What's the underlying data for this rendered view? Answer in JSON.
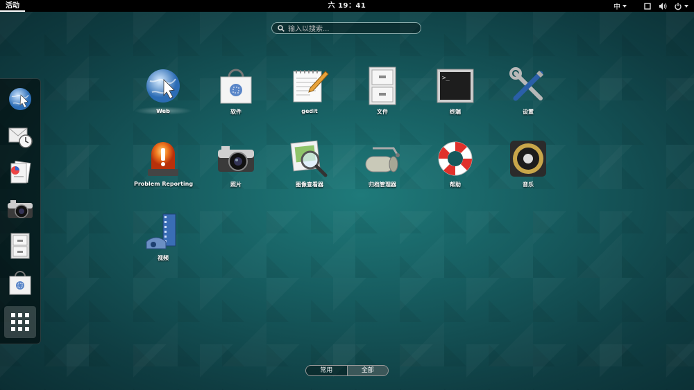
{
  "topbar": {
    "activities_label": "活动",
    "clock": "六 19：41",
    "ime_label": "中",
    "tray_icons": [
      "window-icon",
      "volume-icon",
      "power-icon"
    ]
  },
  "search": {
    "placeholder": "输入以搜索..."
  },
  "dash": {
    "items": [
      {
        "name": "web-browser",
        "icon": "globe-icon"
      },
      {
        "name": "mail-clock",
        "icon": "envelope-clock-icon"
      },
      {
        "name": "documents",
        "icon": "documents-icon"
      },
      {
        "name": "camera",
        "icon": "camera-icon"
      },
      {
        "name": "file-cabinet",
        "icon": "cabinet-icon"
      },
      {
        "name": "software",
        "icon": "shopping-bag-icon"
      },
      {
        "name": "show-applications",
        "icon": "grid-icon"
      }
    ]
  },
  "apps": [
    {
      "label": "Web",
      "icon": "globe-icon"
    },
    {
      "label": "软件",
      "icon": "shopping-bag-icon"
    },
    {
      "label": "gedit",
      "icon": "notepad-pen-icon"
    },
    {
      "label": "文件",
      "icon": "cabinet-icon"
    },
    {
      "label": "终端",
      "icon": "terminal-icon"
    },
    {
      "label": "设置",
      "icon": "tools-icon"
    },
    {
      "label": "Problem Reporting",
      "icon": "alarm-light-icon"
    },
    {
      "label": "照片",
      "icon": "camera-icon"
    },
    {
      "label": "图像查看器",
      "icon": "image-magnifier-icon"
    },
    {
      "label": "归档管理器",
      "icon": "archive-roller-icon"
    },
    {
      "label": "帮助",
      "icon": "lifebuoy-icon"
    },
    {
      "label": "音乐",
      "icon": "speaker-icon"
    },
    {
      "label": "视频",
      "icon": "film-reel-icon"
    }
  ],
  "bottom_tabs": [
    {
      "label": "常用",
      "active": false
    },
    {
      "label": "全部",
      "active": true
    }
  ],
  "colors": {
    "background": "#175e61",
    "topbar": "#000000",
    "text": "#ffffff"
  }
}
